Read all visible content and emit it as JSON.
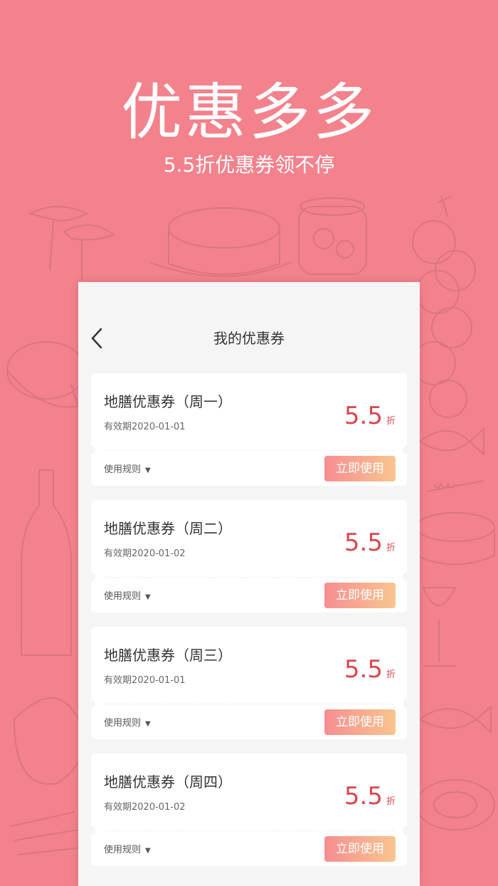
{
  "hero": {
    "title": "优惠多多",
    "subtitle": "5.5折优惠券领不停"
  },
  "header": {
    "back_icon": "chevron-left-icon",
    "title": "我的优惠券"
  },
  "coupons": [
    {
      "name": "地膳优惠券（周一）",
      "date": "有效期2020-01-01",
      "value": "5.5",
      "unit": "折",
      "rules": "使用规则",
      "button": "立即使用"
    },
    {
      "name": "地膳优惠券（周二）",
      "date": "有效期2020-01-02",
      "value": "5.5",
      "unit": "折",
      "rules": "使用规则",
      "button": "立即使用"
    },
    {
      "name": "地膳优惠券（周三）",
      "date": "有效期2020-01-01",
      "value": "5.5",
      "unit": "折",
      "rules": "使用规则",
      "button": "立即使用"
    },
    {
      "name": "地膳优惠券（周四）",
      "date": "有效期2020-01-02",
      "value": "5.5",
      "unit": "折",
      "rules": "使用规则",
      "button": "立即使用"
    }
  ],
  "colors": {
    "background": "#f3828c",
    "accent_red": "#d9474f",
    "button_gradient_start": "#f68e93",
    "button_gradient_end": "#f8c58e"
  }
}
